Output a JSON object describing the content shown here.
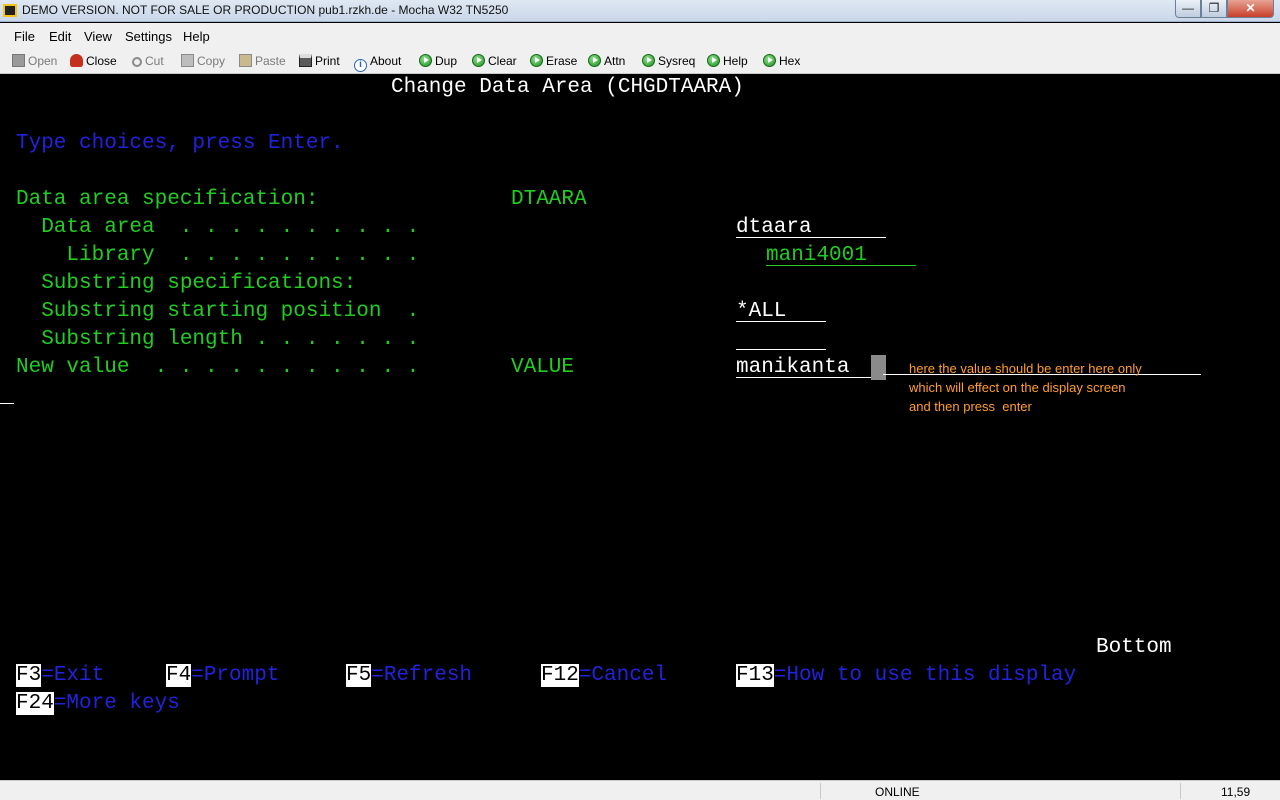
{
  "window": {
    "title": "DEMO VERSION. NOT FOR SALE OR PRODUCTION pub1.rzkh.de - Mocha W32 TN5250",
    "minimize": "—",
    "maximize": "❐",
    "close": "✕"
  },
  "menu": [
    "File",
    "Edit",
    "View",
    "Settings",
    "Help"
  ],
  "toolbar": [
    {
      "label": "Open",
      "icon": "open-icon",
      "enabled": false
    },
    {
      "label": "Close",
      "icon": "close-icon",
      "enabled": true
    },
    {
      "label": "Cut",
      "icon": "cut-icon",
      "enabled": false
    },
    {
      "label": "Copy",
      "icon": "copy-icon",
      "enabled": false
    },
    {
      "label": "Paste",
      "icon": "paste-icon",
      "enabled": false
    },
    {
      "label": "Print",
      "icon": "print-icon",
      "enabled": true
    },
    {
      "label": "About",
      "icon": "info-icon",
      "enabled": true
    },
    {
      "label": "Dup",
      "icon": "go-icon",
      "enabled": true
    },
    {
      "label": "Clear",
      "icon": "go-icon",
      "enabled": true
    },
    {
      "label": "Erase",
      "icon": "go-icon",
      "enabled": true
    },
    {
      "label": "Attn",
      "icon": "go-icon",
      "enabled": true
    },
    {
      "label": "Sysreq",
      "icon": "go-icon",
      "enabled": true
    },
    {
      "label": "Help",
      "icon": "go-icon",
      "enabled": true
    },
    {
      "label": "Hex",
      "icon": "go-icon",
      "enabled": true
    }
  ],
  "screen": {
    "title": "Change Data Area (CHGDTAARA)",
    "instructions": "Type choices, press Enter.",
    "rows": {
      "spec_label": "Data area specification:",
      "spec_keyword": "DTAARA",
      "data_area_label": "  Data area  . . . . . . . . . .",
      "data_area_value": "dtaara",
      "library_label": "    Library  . . . . . . . . . .",
      "library_value": "mani4001",
      "substring_spec_label": "  Substring specifications:",
      "substring_start_label": "  Substring starting position  .",
      "substring_start_value": "*ALL",
      "substring_length_label": "  Substring length . . . . . . .",
      "substring_length_value": "",
      "new_value_label": "New value  . . . . . . . . . . .",
      "new_value_keyword": "VALUE",
      "new_value_value": "manikanta"
    },
    "annotation": "here the value should be enter here only\nwhich will effect on the display screen\nand then press  enter",
    "bottom_indicator": "Bottom",
    "function_keys": [
      {
        "key": "F3",
        "label": "=Exit"
      },
      {
        "key": "F4",
        "label": "=Prompt"
      },
      {
        "key": "F5",
        "label": "=Refresh"
      },
      {
        "key": "F12",
        "label": "=Cancel"
      },
      {
        "key": "F13",
        "label": "=How to use this display"
      },
      {
        "key": "F24",
        "label": "=More keys"
      }
    ]
  },
  "status": {
    "connection": "ONLINE",
    "cursor_position": "11,59"
  },
  "colors": {
    "screen_bg": "#000000",
    "text_green": "#22cc22",
    "text_blue": "#2222dd",
    "text_white": "#ffffff",
    "annotation": "#ff9e2c"
  }
}
